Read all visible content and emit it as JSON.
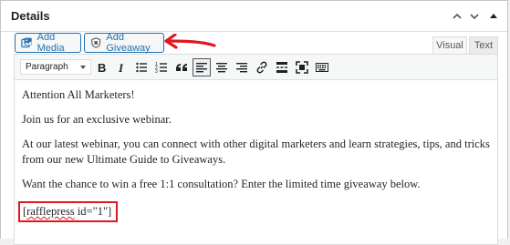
{
  "panel": {
    "title": "Details"
  },
  "buttons": {
    "add_media": "Add Media",
    "add_giveaway": "Add Giveaway"
  },
  "tabs": [
    {
      "label": "Visual",
      "active": true
    },
    {
      "label": "Text",
      "active": false
    }
  ],
  "toolbar": {
    "format_value": "Paragraph",
    "buttons": [
      "bold",
      "italic",
      "bulleted-list",
      "numbered-list",
      "blockquote",
      "align-left",
      "align-center",
      "align-right",
      "link",
      "read-more",
      "fullscreen",
      "toolbar-toggle"
    ]
  },
  "content": {
    "paragraphs": [
      "Attention All Marketers!",
      "Join us for an exclusive webinar.",
      "At our latest webinar, you can connect with other digital marketers and learn strategies, tips, and tricks from our new Ultimate Guide to Giveaways.",
      "Want the chance to win a free 1:1 consultation? Enter the limited time giveaway below."
    ],
    "shortcode_word": "rafflepress",
    "shortcode_rest": " id=\"1\"]",
    "shortcode_open": "["
  },
  "colors": {
    "accent": "#2271b1",
    "highlight": "#e1161e"
  }
}
